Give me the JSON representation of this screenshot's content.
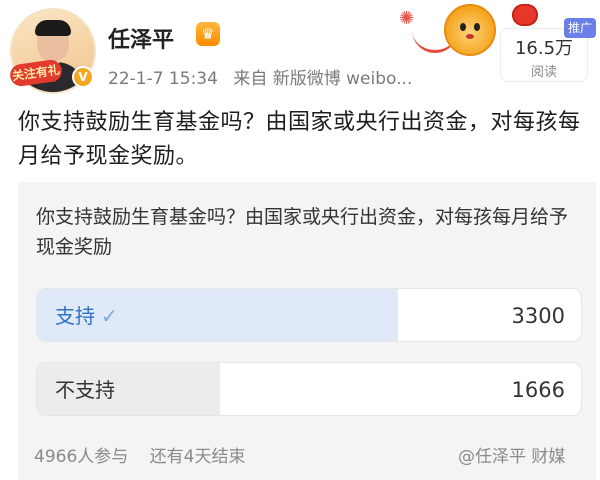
{
  "author": {
    "name": "任泽平",
    "follow_badge": "关注有礼",
    "vip_icon": "vip-crown-icon",
    "verified_icon": "verified-v-icon"
  },
  "meta": {
    "time": "22-1-7 15:34",
    "source": "来自 新版微博 weibo..."
  },
  "stats": {
    "promo_tag": "推广",
    "views": "16.5万",
    "views_label": "阅读"
  },
  "post": {
    "text": "你支持鼓励生育基金吗？由国家或央行出资金，对每孩每月给予现金奖励。"
  },
  "poll": {
    "question": "你支持鼓励生育基金吗？由国家或央行出资金，对每孩每月给予现金奖励",
    "options": [
      {
        "label": "支持",
        "count": "3300",
        "share": 0.6645,
        "selected": true
      },
      {
        "label": "不支持",
        "count": "1666",
        "share": 0.3355,
        "selected": false
      }
    ],
    "participants": "4966人参与",
    "time_left": "还有4天结束"
  },
  "watermark": "@任泽平 财媒",
  "colors": {
    "accent": "#2f72c4",
    "selected_fill": "#dfe9f8",
    "unselected_fill": "#ececec",
    "promo": "#6a7fe8"
  }
}
